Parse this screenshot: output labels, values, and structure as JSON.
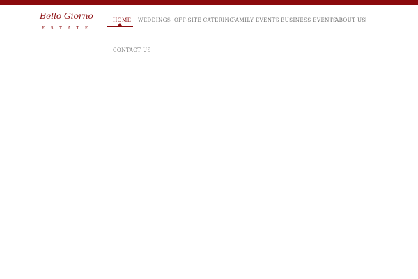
{
  "brand": {
    "name_script": "Bello Giorno",
    "name_sub": "ESTATE",
    "accent_color": "#8b0a0d"
  },
  "nav": {
    "items": [
      {
        "label": "HOME",
        "active": true
      },
      {
        "label": "WEDDINGS",
        "active": false
      },
      {
        "label": "OFF-SITE CATERING",
        "active": false
      },
      {
        "label": "FAMILY EVENTS",
        "active": false
      },
      {
        "label": "BUSINESS EVENTS",
        "active": false
      },
      {
        "label": "ABOUT US",
        "active": false
      },
      {
        "label": "CONTACT US",
        "active": false
      }
    ]
  }
}
